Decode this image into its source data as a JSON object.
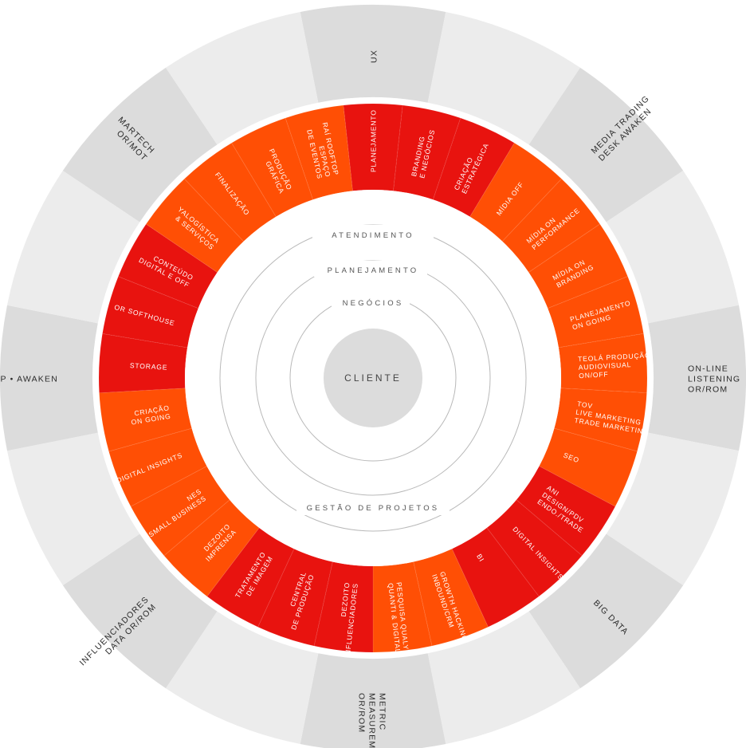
{
  "center": {
    "label": "CLIENTE"
  },
  "rings": {
    "atendimento": "ATENDIMENTO",
    "planejamento": "PLANEJAMENTO",
    "negocios": "NEGÓCIOS",
    "gestao": "GESTÃO DE PROJETOS"
  },
  "outer_segments": [
    {
      "label": [
        "UX"
      ]
    },
    {
      "label": [
        "MEDIA TRADING",
        "DESK AWAKEN"
      ]
    },
    {
      "label": [
        "ON-LINE",
        "LISTENING",
        "OR/ROM"
      ]
    },
    {
      "label": [
        "BIG DATA"
      ]
    },
    {
      "label": [
        "METRIC",
        "MEASUREMENT",
        "OR/ROM"
      ]
    },
    {
      "label": [
        "INFLUENCIADORES",
        "DATA OR/ROM"
      ]
    },
    {
      "label": [
        "DMP • AWAKEN"
      ]
    },
    {
      "label": [
        "MARTECH",
        "OR/MOT"
      ]
    }
  ],
  "inner_segments": [
    {
      "label": [
        "PLANEJAMENTO"
      ]
    },
    {
      "label": [
        "BRANDING",
        "E NEGÓCIOS"
      ]
    },
    {
      "label": [
        "CRIAÇÃO",
        "ESTRATÉGICA"
      ]
    },
    {
      "label": [
        "MÍDIA OFF"
      ]
    },
    {
      "label": [
        "MÍDIA ON",
        "PERFORMANCE"
      ]
    },
    {
      "label": [
        "MÍDIA ON",
        "BRANDING"
      ]
    },
    {
      "label": [
        "PLANEJAMENTO",
        "ON GOING"
      ]
    },
    {
      "label": [
        "TEOLÁ PRODUÇÃO",
        "AUDIOVISUAL",
        "ON/OFF"
      ]
    },
    {
      "label": [
        "TOV",
        "LIVE MARKETING",
        "TRADE MARKETING"
      ]
    },
    {
      "label": [
        "SEO"
      ]
    },
    {
      "label": [
        "ANI",
        "DESIGN/PDV",
        "ENDO./TRADE"
      ]
    },
    {
      "label": [
        "DIGITAL INSIGHTS"
      ]
    },
    {
      "label": [
        "BI"
      ]
    },
    {
      "label": [
        "GROWTH HACKING/",
        "INBOUND/CRM"
      ]
    },
    {
      "label": [
        "PESQUISA QUALY",
        "QUANTI & DIGITAL"
      ]
    },
    {
      "label": [
        "DEZOITO",
        "INFLUENCIADORES"
      ]
    },
    {
      "label": [
        "CENTRAL",
        "DE PRODUÇÃO"
      ]
    },
    {
      "label": [
        "TRATAMENTO",
        "DE IMAGEM"
      ]
    },
    {
      "label": [
        "DEZOITO",
        "IMPRENSA"
      ]
    },
    {
      "label": [
        "NES",
        "SMALL BUSINESS"
      ]
    },
    {
      "label": [
        "DIGITAL INSIGHTS"
      ]
    },
    {
      "label": [
        "CRIAÇÃO",
        "ON GOING"
      ]
    },
    {
      "label": [
        "STORAGE"
      ]
    },
    {
      "label": [
        "OR SOFTHOUSE"
      ]
    },
    {
      "label": [
        "CONTEÚDO",
        "DIGITAL E OFF"
      ]
    },
    {
      "label": [
        "YALOGÍSTICA",
        "& SERVIÇOS"
      ]
    },
    {
      "label": [
        "FINALIZAÇÃO"
      ]
    },
    {
      "label": [
        "PRODUÇÃO",
        "GRÁFICA"
      ]
    },
    {
      "label": [
        "RAÍ ROOFTOP",
        "ESPAÇO",
        "DE EVENTOS"
      ]
    }
  ],
  "colors": {
    "outer_light": "#ececec",
    "outer_dark": "#dcdcdc",
    "inner_red": "#e8130f",
    "inner_orange": "#ff4f05",
    "ring_stroke": "#b9b9b9",
    "center_fill": "#dcdcdc"
  }
}
